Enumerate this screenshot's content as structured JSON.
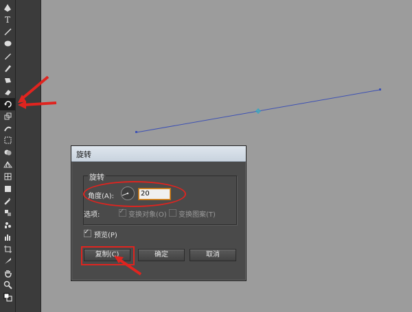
{
  "toolbar": {
    "tools": [
      "pen-tool-icon",
      "type-tool-icon",
      "line-tool-icon",
      "ellipse-tool-icon",
      "paintbrush-tool-icon",
      "pencil-tool-icon",
      "blob-brush-tool-icon",
      "eraser-tool-icon",
      "rotate-tool-icon",
      "scale-tool-icon",
      "warp-tool-icon",
      "free-transform-tool-icon",
      "shape-builder-tool-icon",
      "perspective-grid-tool-icon",
      "mesh-tool-icon",
      "gradient-tool-icon",
      "eyedropper-tool-icon",
      "blend-tool-icon",
      "symbol-sprayer-tool-icon",
      "column-graph-tool-icon",
      "artboard-tool-icon",
      "slice-tool-icon",
      "hand-tool-icon",
      "zoom-tool-icon",
      "fill-stroke-swatch-icon"
    ],
    "active_tool": "rotate-tool-icon"
  },
  "dialog": {
    "title": "旋转",
    "group_label": "旋转",
    "angle_label": "角度(A):",
    "angle_value": "20",
    "options_label": "选项:",
    "transform_objects_label": "变换对象(O)",
    "transform_objects_checked": true,
    "transform_patterns_label": "变换图案(T)",
    "transform_patterns_checked": false,
    "preview_label": "预览(P)",
    "preview_checked": true,
    "copy_button": "复制(C)",
    "ok_button": "确定",
    "cancel_button": "取消"
  },
  "colors": {
    "annotation": "#e0241f",
    "path_stroke": "#3c50b4",
    "canvas_bg": "#9c9c9c"
  }
}
